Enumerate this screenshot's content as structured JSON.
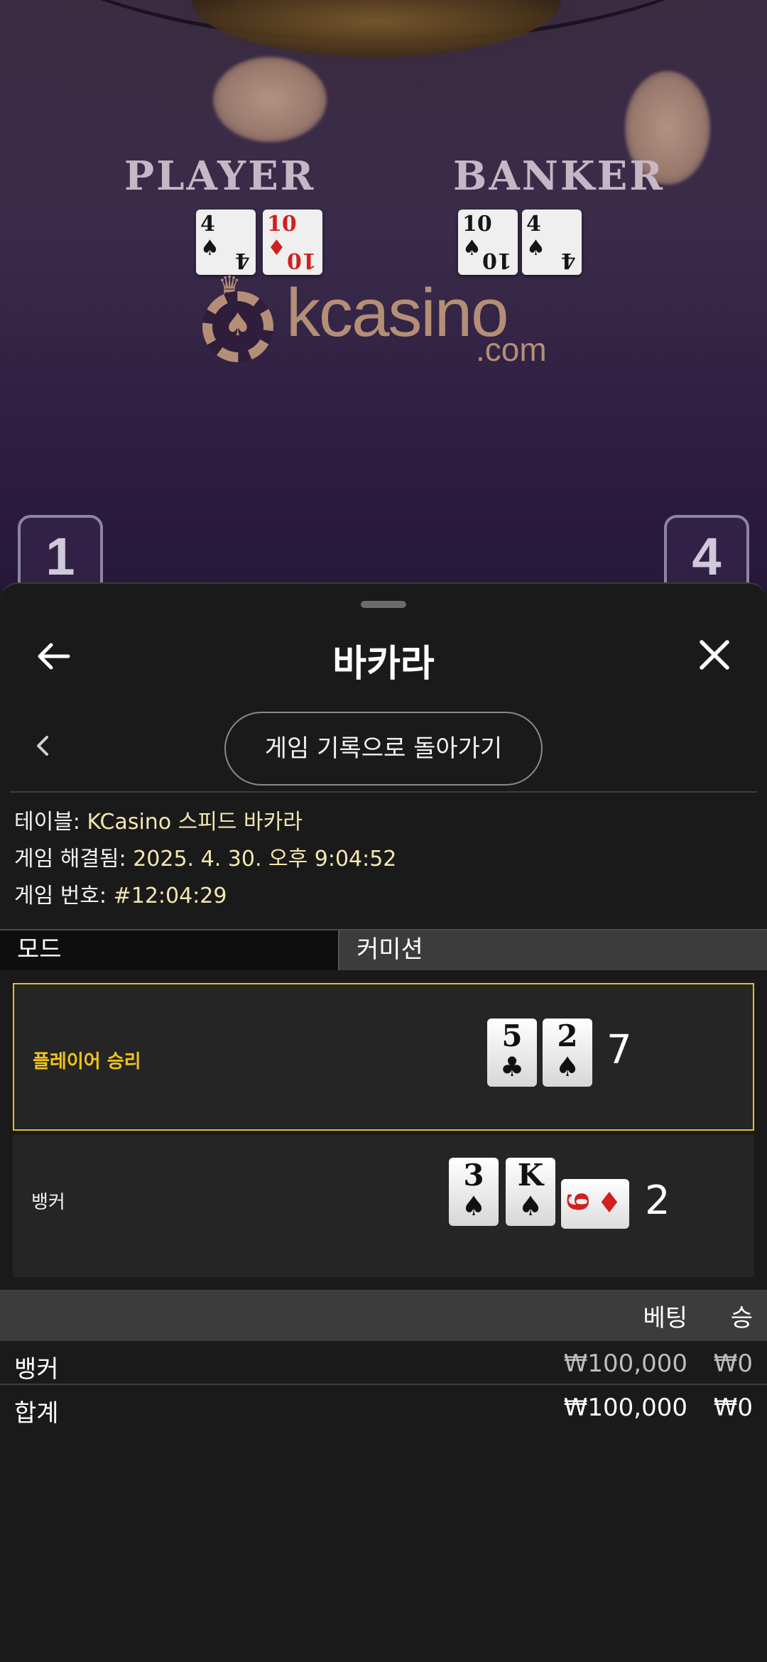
{
  "video": {
    "player_label": "PLAYER",
    "banker_label": "BANKER",
    "player_cards": [
      {
        "rank": "4",
        "suit": "♠",
        "color": "black"
      },
      {
        "rank": "10",
        "suit": "♦",
        "color": "red"
      }
    ],
    "banker_cards": [
      {
        "rank": "10",
        "suit": "♠",
        "color": "black"
      },
      {
        "rank": "4",
        "suit": "♠",
        "color": "black"
      }
    ],
    "logo_brand": "kcasino",
    "logo_domain": ".com",
    "seat_left": "1",
    "seat_right": "4"
  },
  "header": {
    "title": "바카라",
    "back_icon": "arrow-left-icon",
    "close_icon": "close-icon"
  },
  "nav": {
    "prev_icon": "chevron-left-icon",
    "back_to_history_label": "게임 기록으로 돌아가기"
  },
  "info": {
    "table_key": "테이블: ",
    "table_value": "KCasino 스피드 바카라",
    "resolved_key": "게임 해결됨: ",
    "resolved_value": "2025. 4. 30. 오후 9:04:52",
    "number_key": "게임 번호: ",
    "number_value": "#12:04:29"
  },
  "tabs": {
    "mode": "모드",
    "commission": "커미션"
  },
  "results": {
    "player": {
      "label": "플레이어 승리",
      "score": "7",
      "cards": [
        {
          "rank": "5",
          "suit": "♣"
        },
        {
          "rank": "2",
          "suit": "♠"
        }
      ]
    },
    "banker": {
      "label": "뱅커",
      "score": "2",
      "cards": [
        {
          "rank": "3",
          "suit": "♠"
        },
        {
          "rank": "K",
          "suit": "♠"
        },
        {
          "rank": "9",
          "suit": "♦"
        }
      ]
    },
    "highlight_color": "#e2bf22"
  },
  "bets": {
    "headers": {
      "bet": "베팅",
      "win": "승"
    },
    "rows": [
      {
        "name": "뱅커",
        "bet": "₩100,000",
        "win": "₩0"
      }
    ],
    "total": {
      "name": "합계",
      "bet": "₩100,000",
      "win": "₩0"
    }
  }
}
